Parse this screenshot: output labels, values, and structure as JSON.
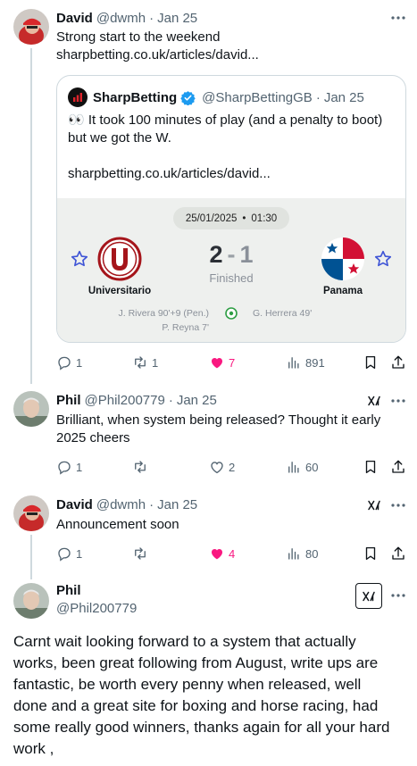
{
  "posts": [
    {
      "author": "David",
      "handle": "@dwmh",
      "date": "Jan 25",
      "text": "Strong start to the weekend",
      "link": "sharpbetting.co.uk/articles/david...",
      "quote": {
        "author": "SharpBetting",
        "handle": "@SharpBettingGB",
        "date": "Jan 25",
        "text_line1": "👀 It took 100 minutes of play (and a penalty to boot)",
        "text_line2": "but we got the W.",
        "link": "sharpbetting.co.uk/articles/david...",
        "match": {
          "date": "25/01/2025",
          "time": "01:30",
          "home_team": "Universitario",
          "away_team": "Panama",
          "home_score": "2",
          "away_score": "1",
          "status": "Finished",
          "home_scorers": [
            "J. Rivera 90'+9 (Pen.)",
            "P. Reyna 7'"
          ],
          "away_scorers": [
            "G. Herrera 49'"
          ]
        }
      },
      "stats": {
        "replies": "1",
        "reposts": "1",
        "likes": "7",
        "views": "891"
      }
    },
    {
      "author": "Phil",
      "handle": "@Phil200779",
      "date": "Jan 25",
      "text_line1": "Brilliant, when system being released? Thought it early",
      "text_line2": "2025 cheers",
      "stats": {
        "replies": "1",
        "reposts": "",
        "likes": "2",
        "views": "60"
      }
    },
    {
      "author": "David",
      "handle": "@dwmh",
      "date": "Jan 25",
      "text": "Announcement soon",
      "stats": {
        "replies": "1",
        "reposts": "",
        "likes": "4",
        "views": "80"
      }
    }
  ],
  "focus_post": {
    "author": "Phil",
    "handle": "@Phil200779",
    "lines": [
      "Carnt wait looking forward to a system that actually",
      "works, been great following from August, write ups are",
      "fantastic, be worth every penny when released, well",
      "done and a great site for boxing and horse racing, had",
      "some really good winners, thanks again for all your hard",
      "work ,"
    ]
  },
  "colors": {
    "like_active": "#f91880",
    "link": "#1d9bf0",
    "verified": "#1d9bf0",
    "muted": "#536471",
    "universitario_red": "#a5151b"
  }
}
